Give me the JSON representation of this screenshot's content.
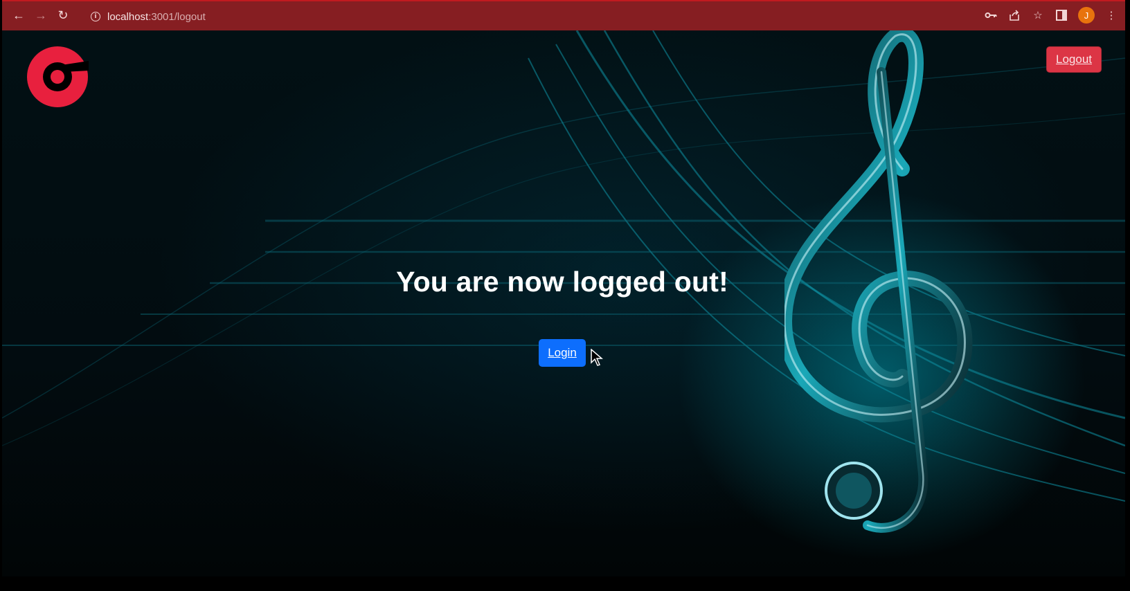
{
  "browser": {
    "url_host": "localhost",
    "url_path": ":3001/logout",
    "profile_initial": "J",
    "colors": {
      "toolbar": "#861e22",
      "profile": "#e8730d"
    },
    "icons": [
      "back-icon",
      "forward-icon",
      "reload-icon",
      "info-icon",
      "key-icon",
      "share-icon",
      "star-icon",
      "side-panel-icon",
      "more-icon"
    ]
  },
  "header": {
    "logout_label": "Logout"
  },
  "main": {
    "heading": "You are now logged out!",
    "login_label": "Login"
  },
  "colors": {
    "logout_button": "#dc3545",
    "login_button": "#0d6efd",
    "logo": "#e8203e",
    "accent_teal": "#19c4d6"
  }
}
